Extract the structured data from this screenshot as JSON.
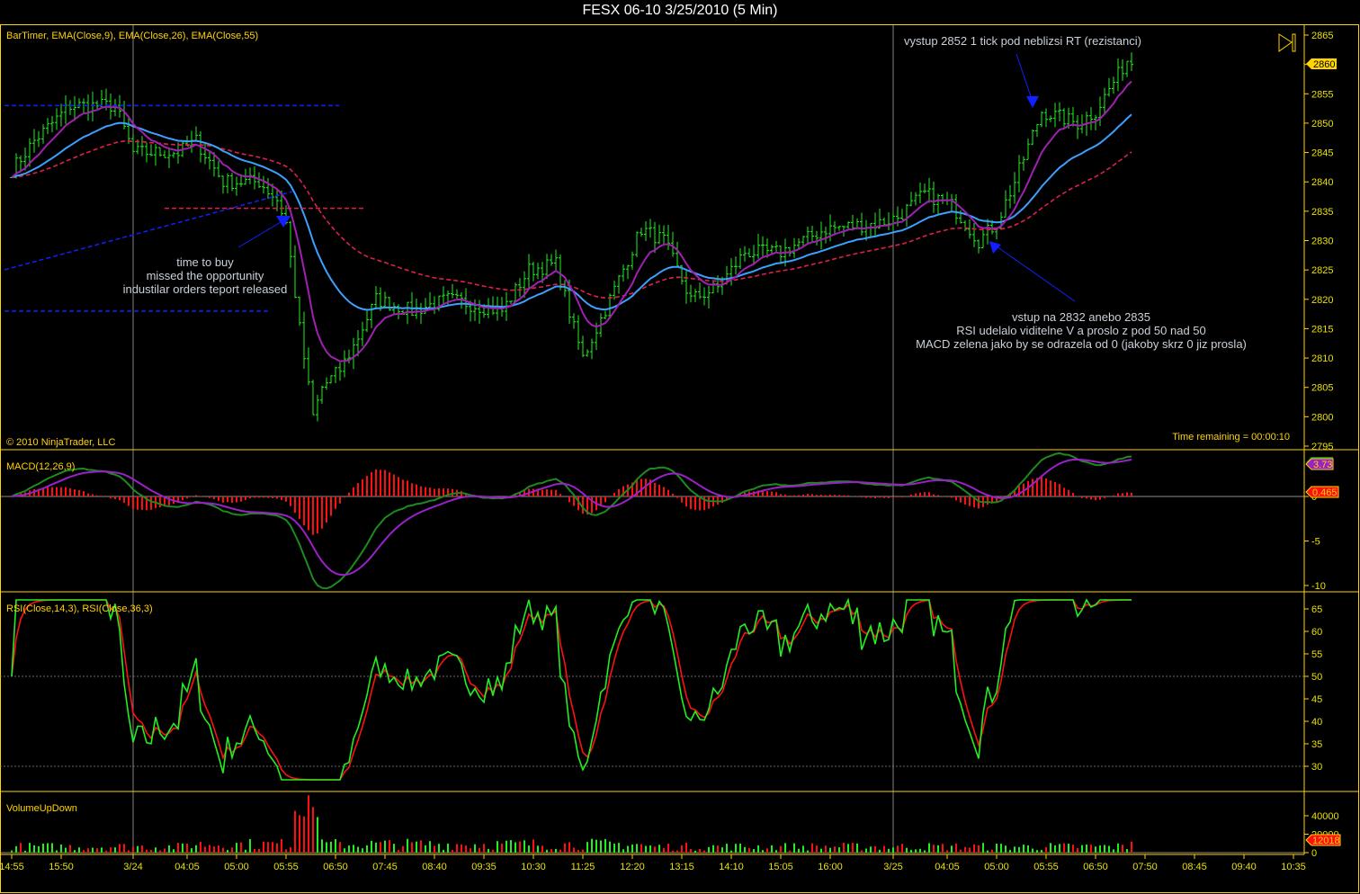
{
  "title": "FESX 06-10  3/25/2010 (5 Min)",
  "labels": {
    "price": "BarTimer, EMA(Close,9), EMA(Close,26), EMA(Close,55)",
    "macd": "MACD(12,26,9)",
    "rsi": "RSI(Close,14,3), RSI(Close,36,3)",
    "volume": "VolumeUpDown",
    "copyright": "© 2010 NinjaTrader, LLC",
    "timer": "Time remaining = 00:00:10"
  },
  "annotations": {
    "top": "vystup 2852 1 tick pod neblizsi RT (rezistanci)",
    "left": [
      "time to buy",
      "missed the opportunity",
      "industilar orders teport released"
    ],
    "right": [
      "vstup na 2832 anebo 2835",
      "RSI udelalo viditelne V a proslo z pod 50 nad 50",
      "MACD zelena jako by se odrazela od 0 (jakoby skrz 0 jiz prosla)"
    ]
  },
  "markers": {
    "price": "2860",
    "macd": "3.73",
    "macd_diff": "0.465",
    "volume": "12018"
  },
  "colors": {
    "up": "#22ee22",
    "down": "#ff1010",
    "ema9": "#a020b0",
    "ema26": "#3ca0ff",
    "ema55": "#e0204a",
    "axis": "#ffd400",
    "macd": "#1e8a1e",
    "macd_avg": "#9a20c8"
  },
  "chart_data": {
    "type": "line",
    "title": "FESX 06-10  3/25/2010 (5 Min)",
    "price_ticks": [
      "2865",
      "2860",
      "2855",
      "2850",
      "2845",
      "2840",
      "2835",
      "2830",
      "2825",
      "2820",
      "2815",
      "2810",
      "2805",
      "2800",
      "2795"
    ],
    "macd_ticks": [
      "0",
      "-5",
      "-10"
    ],
    "rsi_ticks": [
      "65",
      "60",
      "55",
      "50",
      "45",
      "40",
      "35",
      "30"
    ],
    "volume_ticks": [
      "40000",
      "20000",
      "0"
    ],
    "time_ticks": [
      [
        "14:55",
        0
      ],
      [
        "15:50",
        11
      ],
      [
        "3/24",
        27
      ],
      [
        "04:05",
        39
      ],
      [
        "05:00",
        50
      ],
      [
        "05:55",
        61
      ],
      [
        "06:50",
        72
      ],
      [
        "07:45",
        83
      ],
      [
        "08:40",
        94
      ],
      [
        "09:35",
        105
      ],
      [
        "10:30",
        116
      ],
      [
        "11:25",
        127
      ],
      [
        "12:20",
        138
      ],
      [
        "13:15",
        149
      ],
      [
        "14:10",
        160
      ],
      [
        "15:05",
        171
      ],
      [
        "16:00",
        182
      ],
      [
        "3/25",
        196
      ],
      [
        "04:05",
        208
      ],
      [
        "05:00",
        219
      ],
      [
        "05:55",
        230
      ],
      [
        "06:50",
        241
      ],
      [
        "07:50",
        252
      ],
      [
        "08:45",
        263
      ],
      [
        "09:40",
        274
      ],
      [
        "10:35",
        285
      ]
    ],
    "price_ylim": [
      2795,
      2866
    ],
    "close_path_bar_price": [
      [
        0,
        2842
      ],
      [
        5,
        2847
      ],
      [
        13,
        2853
      ],
      [
        23,
        2853
      ],
      [
        27,
        2845
      ],
      [
        37,
        2845
      ],
      [
        41,
        2847
      ],
      [
        47,
        2840
      ],
      [
        55,
        2840
      ],
      [
        59,
        2837
      ],
      [
        61,
        2833
      ],
      [
        64,
        2815
      ],
      [
        67,
        2800
      ],
      [
        69,
        2805
      ],
      [
        73,
        2808
      ],
      [
        76,
        2812
      ],
      [
        81,
        2820
      ],
      [
        89,
        2818
      ],
      [
        97,
        2820
      ],
      [
        109,
        2818
      ],
      [
        115,
        2825
      ],
      [
        121,
        2826
      ],
      [
        125,
        2815
      ],
      [
        127,
        2810
      ],
      [
        133,
        2820
      ],
      [
        140,
        2832
      ],
      [
        145,
        2830
      ],
      [
        151,
        2820
      ],
      [
        157,
        2822
      ],
      [
        163,
        2828
      ],
      [
        171,
        2828
      ],
      [
        181,
        2832
      ],
      [
        193,
        2833
      ],
      [
        197,
        2834
      ],
      [
        203,
        2838
      ],
      [
        209,
        2836
      ],
      [
        215,
        2830
      ],
      [
        219,
        2833
      ],
      [
        223,
        2840
      ],
      [
        227,
        2848
      ],
      [
        229,
        2852
      ],
      [
        237,
        2850
      ],
      [
        241,
        2852
      ],
      [
        245,
        2857
      ],
      [
        249,
        2862
      ]
    ],
    "last_price": 2860,
    "macd_last": 3.73,
    "macd_diff_last": 0.465,
    "volume_last": 12018
  }
}
